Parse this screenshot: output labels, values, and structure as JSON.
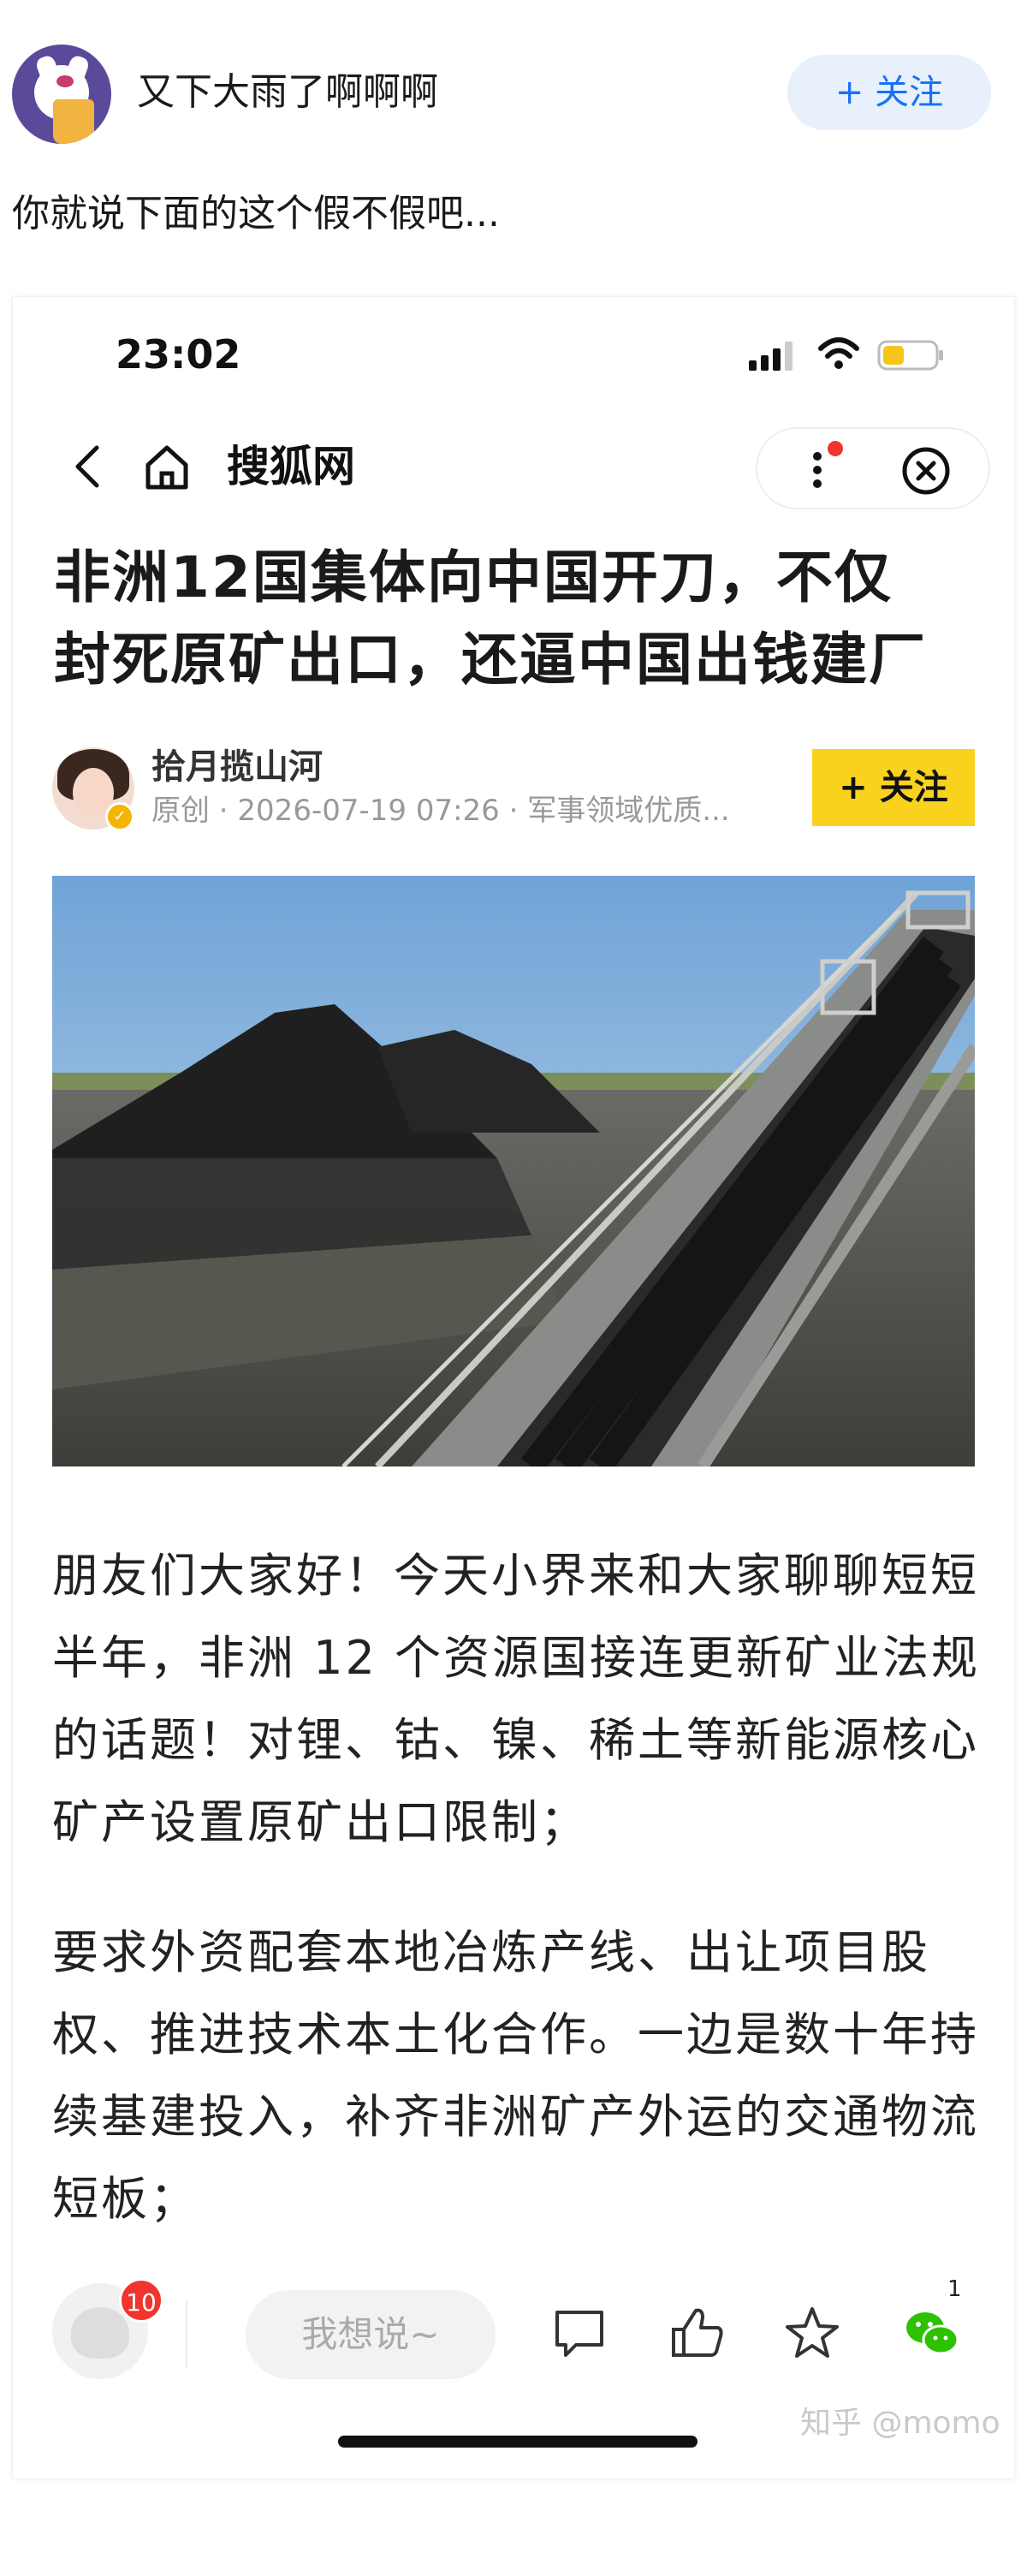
{
  "post": {
    "author_name": "又下大雨了啊啊啊",
    "follow_label": "+ 关注",
    "text": "你就说下面的这个假不假吧..."
  },
  "screenshot": {
    "status_time": "23:02",
    "site_name": "搜狐网",
    "title_line1": "非洲12国集体向中国开刀，不仅",
    "title_line2": "封死原矿出口，还逼中国出钱建厂",
    "author": {
      "name": "拾月揽山河",
      "meta": "原创 · 2026-07-19 07:26 · 军事领域优质..."
    },
    "follow_label": "+ 关注",
    "paragraphs": [
      "朋友们大家好！今天小界来和大家聊聊短短半年，非洲 12 个资源国接连更新矿业法规的话题！对锂、钴、镍、稀土等新能源核心矿产设置原矿出口限制；",
      "要求外资配套本地冶炼产线、出让项目股权、推进技术本土化合作。一边是数十年持续基建投入，补齐非洲矿产外运的交通物流短板；"
    ],
    "bottom_bar": {
      "badge_count": "10",
      "input_placeholder": "我想说~",
      "wechat_count": "1"
    },
    "watermark": "知乎 @momo"
  },
  "colors": {
    "zhihu_blue": "#1772f6",
    "follow_bg": "#e8f0fc",
    "sohu_yellow": "#f9d21e",
    "badge_red": "#f0352e",
    "wechat_green": "#2dc100"
  }
}
